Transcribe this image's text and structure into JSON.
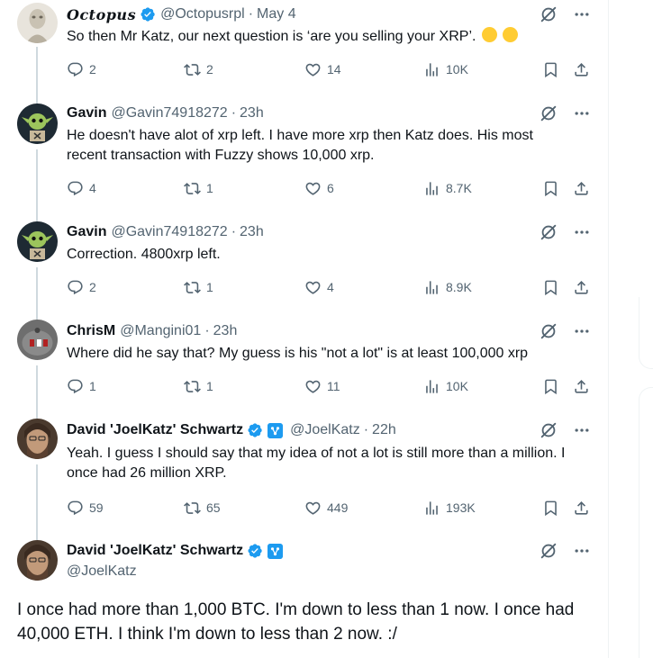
{
  "tweets": [
    {
      "name": "Octopus",
      "handle": "@Octopusrpl",
      "time": "May 4",
      "text": "So then Mr Katz, our next question is ‘are you selling your XRP’.",
      "replies": "2",
      "retweets": "2",
      "likes": "14",
      "views": "10K"
    },
    {
      "name": "Gavin",
      "handle": "@Gavin74918272",
      "time": "23h",
      "text": "He doesn't have alot of xrp left. I have more xrp then Katz does. His most recent transaction with Fuzzy shows 10,000 xrp.",
      "replies": "4",
      "retweets": "1",
      "likes": "6",
      "views": "8.7K"
    },
    {
      "name": "Gavin",
      "handle": "@Gavin74918272",
      "time": "23h",
      "text": "Correction. 4800xrp left.",
      "replies": "2",
      "retweets": "1",
      "likes": "4",
      "views": "8.9K"
    },
    {
      "name": "ChrisM",
      "handle": "@Mangini01",
      "time": "23h",
      "text": "Where did he say that? My guess is his \"not a lot\" is at least 100,000 xrp",
      "replies": "1",
      "retweets": "1",
      "likes": "11",
      "views": "10K"
    },
    {
      "name": "David 'JoelKatz' Schwartz",
      "handle": "@JoelKatz",
      "time": "22h",
      "text": "Yeah. I guess I should say that my idea of not a lot is still more than a million. I once had 26 million XRP.",
      "replies": "59",
      "retweets": "65",
      "likes": "449",
      "views": "193K"
    }
  ],
  "main_tweet": {
    "name": "David 'JoelKatz' Schwartz",
    "handle": "@JoelKatz",
    "text": "I once had more than 1,000 BTC. I'm down to less than 1 now. I once had 40,000 ETH. I think I'm down to less than 2 now. :/"
  },
  "colors": {
    "text": "#0f1419",
    "muted": "#536471",
    "verified": "#1d9bf0",
    "thread_line": "#cfd9de"
  },
  "icons": [
    "reply-icon",
    "retweet-icon",
    "like-icon",
    "views-icon",
    "bookmark-icon",
    "share-icon",
    "grok-icon",
    "more-icon",
    "verified-icon",
    "affiliate-badge-icon"
  ]
}
